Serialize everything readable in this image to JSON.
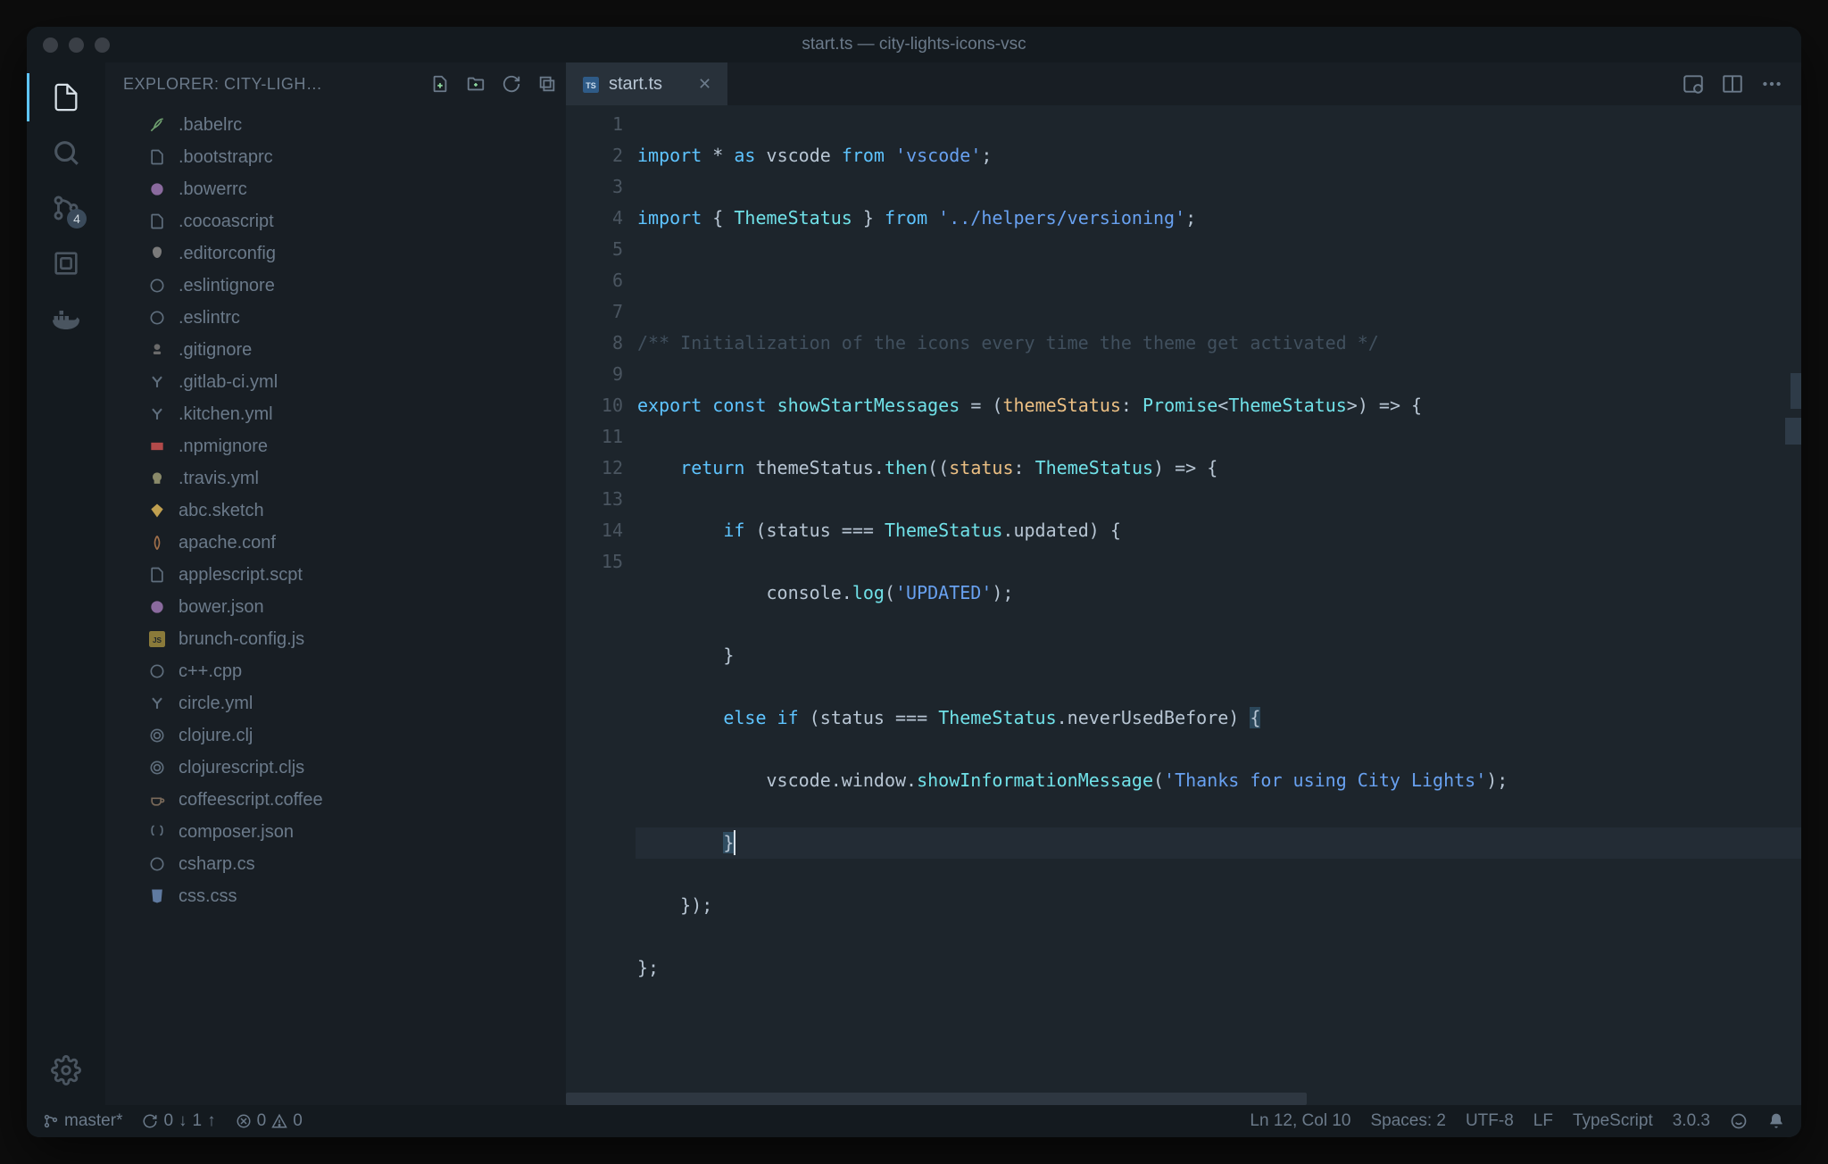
{
  "titlebar": {
    "title": "start.ts — city-lights-icons-vsc"
  },
  "activity": {
    "scm_badge": "4",
    "items": [
      "explorer",
      "search",
      "scm",
      "debug",
      "extensions",
      "docker"
    ],
    "bottom": [
      "settings"
    ]
  },
  "sidebar": {
    "header": "EXPLORER: CITY-LIGH…",
    "actions": [
      "new-file",
      "new-folder",
      "refresh",
      "collapse-all"
    ],
    "files": [
      {
        "icon": "feather",
        "name": ".babelrc"
      },
      {
        "icon": "file",
        "name": ".bootstraprc"
      },
      {
        "icon": "bower",
        "name": ".bowerrc"
      },
      {
        "icon": "file",
        "name": ".cocoascript"
      },
      {
        "icon": "editorconfig",
        "name": ".editorconfig"
      },
      {
        "icon": "eslint",
        "name": ".eslintignore"
      },
      {
        "icon": "eslint",
        "name": ".eslintrc"
      },
      {
        "icon": "git",
        "name": ".gitignore"
      },
      {
        "icon": "yaml",
        "name": ".gitlab-ci.yml"
      },
      {
        "icon": "yaml",
        "name": ".kitchen.yml"
      },
      {
        "icon": "npm",
        "name": ".npmignore"
      },
      {
        "icon": "travis",
        "name": ".travis.yml"
      },
      {
        "icon": "sketch",
        "name": "abc.sketch"
      },
      {
        "icon": "apache",
        "name": "apache.conf"
      },
      {
        "icon": "file",
        "name": "applescript.scpt"
      },
      {
        "icon": "bower",
        "name": "bower.json"
      },
      {
        "icon": "js",
        "name": "brunch-config.js"
      },
      {
        "icon": "cpp",
        "name": "c++.cpp"
      },
      {
        "icon": "yaml",
        "name": "circle.yml"
      },
      {
        "icon": "clojure",
        "name": "clojure.clj"
      },
      {
        "icon": "clojure",
        "name": "clojurescript.cljs"
      },
      {
        "icon": "coffee",
        "name": "coffeescript.coffee"
      },
      {
        "icon": "json",
        "name": "composer.json"
      },
      {
        "icon": "csharp",
        "name": "csharp.cs"
      },
      {
        "icon": "css",
        "name": "css.css"
      }
    ]
  },
  "tab": {
    "label": "start.ts"
  },
  "code": {
    "line_count": 15
  },
  "status": {
    "branch": "master*",
    "sync_down": "0",
    "sync_up": "1",
    "errors": "0",
    "warnings": "0",
    "cursor": "Ln 12, Col 10",
    "spaces": "Spaces: 2",
    "encoding": "UTF-8",
    "eol": "LF",
    "lang": "TypeScript",
    "version": "3.0.3"
  }
}
